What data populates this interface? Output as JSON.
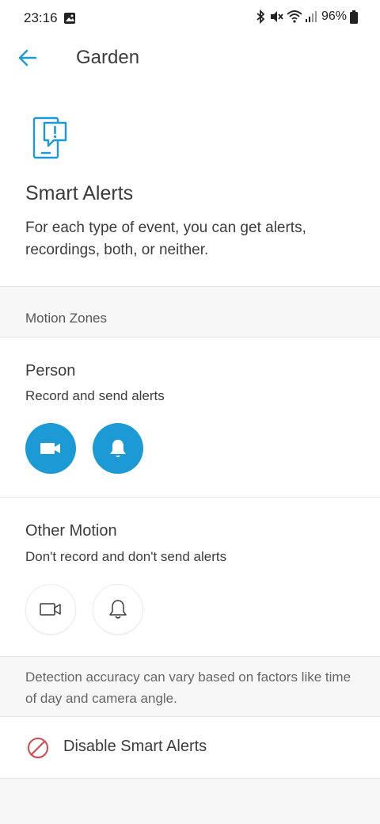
{
  "status_bar": {
    "time": "23:16",
    "battery": "96%",
    "icons": [
      "gallery-icon",
      "bluetooth-icon",
      "mute-icon",
      "wifi-icon",
      "signal-icon",
      "battery-icon"
    ]
  },
  "app_bar": {
    "title": "Garden",
    "back_icon": "arrow-left-icon"
  },
  "smart_alerts": {
    "icon": "alert-device-icon",
    "title": "Smart Alerts",
    "description": "For each type of event, you can get alerts, recordings, both, or neither."
  },
  "motion_zones": {
    "label": "Motion Zones"
  },
  "events": [
    {
      "title": "Person",
      "status": "Record and send alerts",
      "record_on": true,
      "alert_on": true
    },
    {
      "title": "Other Motion",
      "status": "Don't record and don't send alerts",
      "record_on": false,
      "alert_on": false
    }
  ],
  "info": {
    "text": "Detection accuracy can vary based on factors like time of day and camera angle."
  },
  "disable": {
    "label": "Disable Smart Alerts",
    "icon": "prohibited-icon"
  },
  "colors": {
    "accent": "#1c9ad6",
    "danger": "#d0474d",
    "text": "#3c3c3c",
    "muted": "#666666",
    "section_bg": "#f7f7f7"
  }
}
